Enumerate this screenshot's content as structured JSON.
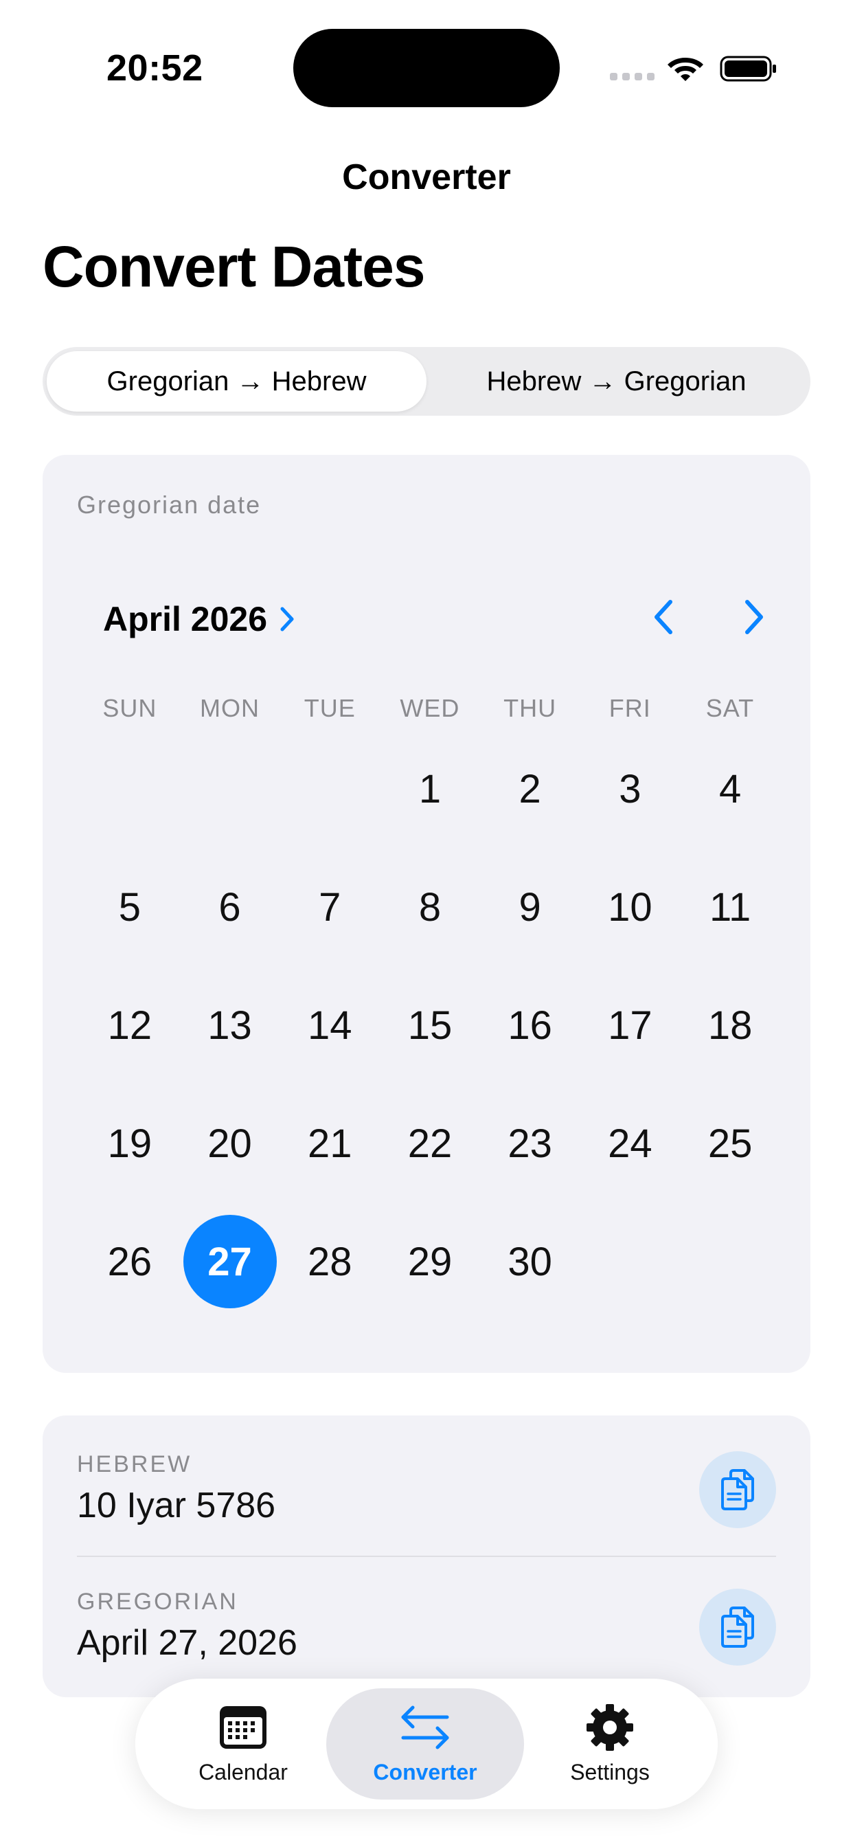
{
  "status_bar": {
    "time": "20:52"
  },
  "nav": {
    "title": "Converter"
  },
  "page": {
    "large_title": "Convert Dates"
  },
  "segmented": {
    "options": [
      "Gregorian → Hebrew",
      "Hebrew → Gregorian"
    ],
    "selected": "Gregorian → Hebrew"
  },
  "calendar": {
    "section_label": "Gregorian date",
    "month_label": "April 2026",
    "weekdays": [
      "SUN",
      "MON",
      "TUE",
      "WED",
      "THU",
      "FRI",
      "SAT"
    ],
    "first_weekday_index": 3,
    "days_in_month": 30,
    "selected_day": 27,
    "days": [
      "1",
      "2",
      "3",
      "4",
      "5",
      "6",
      "7",
      "8",
      "9",
      "10",
      "11",
      "12",
      "13",
      "14",
      "15",
      "16",
      "17",
      "18",
      "19",
      "20",
      "21",
      "22",
      "23",
      "24",
      "25",
      "26",
      "27",
      "28",
      "29",
      "30"
    ]
  },
  "results": {
    "hebrew_label": "HEBREW",
    "hebrew_value": "10 Iyar 5786",
    "gregorian_label": "GREGORIAN",
    "gregorian_value": "April 27, 2026"
  },
  "tabbar": {
    "items": [
      {
        "label": "Calendar",
        "icon": "calendar-icon"
      },
      {
        "label": "Converter",
        "icon": "arrows-swap-icon"
      },
      {
        "label": "Settings",
        "icon": "gear-icon"
      }
    ],
    "selected": "Converter"
  },
  "colors": {
    "accent": "#0a84ff",
    "card": "#f2f2f7",
    "secondary_text": "#8a8a8e"
  }
}
